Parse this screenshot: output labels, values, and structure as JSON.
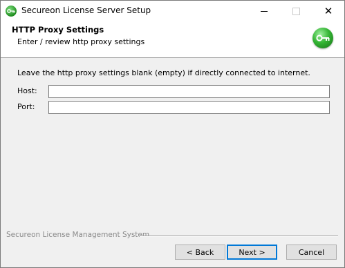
{
  "window": {
    "title": "Secureon License Server Setup",
    "icon": "key-icon",
    "controls": {
      "minimize": "minimize-icon",
      "maximize": "maximize-icon",
      "close": "✕"
    }
  },
  "header": {
    "title": "HTTP Proxy Settings",
    "subtitle": "Enter / review http proxy settings",
    "badge_icon": "key-icon"
  },
  "body": {
    "info": "Leave the http proxy settings blank (empty) if directly connected to internet.",
    "host": {
      "label": "Host:",
      "value": ""
    },
    "port": {
      "label": "Port:",
      "value": ""
    }
  },
  "footer": {
    "brand": "Secureon License Management System",
    "back_label": "< Back",
    "next_label": "Next >",
    "cancel_label": "Cancel"
  },
  "colors": {
    "accent": "#0078d7",
    "badge_green": "#34b534"
  }
}
